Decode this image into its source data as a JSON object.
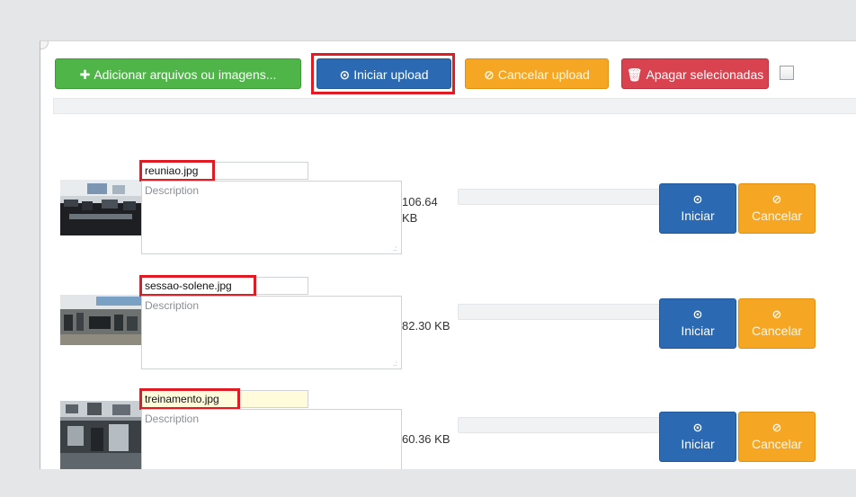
{
  "toolbar": {
    "add_label": "Adicionar arquivos ou imagens...",
    "add_icon": "plus-icon",
    "start_label": "Iniciar upload",
    "start_icon": "circle-arrow-up-icon",
    "cancel_label": "Cancelar upload",
    "cancel_icon": "ban-icon",
    "delete_label": "Apagar selecionadas",
    "delete_icon": "trash-icon"
  },
  "files": [
    {
      "name": "reuniao.jpg",
      "description_placeholder": "Description",
      "size": "106.64 KB",
      "start_label": "Iniciar",
      "cancel_label": "Cancelar"
    },
    {
      "name": "sessao-solene.jpg",
      "description_placeholder": "Description",
      "size": "82.30 KB",
      "start_label": "Iniciar",
      "cancel_label": "Cancelar"
    },
    {
      "name": "treinamento.jpg",
      "description_placeholder": "Description",
      "size": "60.36 KB",
      "start_label": "Iniciar",
      "cancel_label": "Cancelar"
    }
  ],
  "colors": {
    "add": "#4fb548",
    "start": "#2b6ab3",
    "cancel": "#f5a623",
    "delete": "#d9434f",
    "highlight": "#e21a23"
  }
}
